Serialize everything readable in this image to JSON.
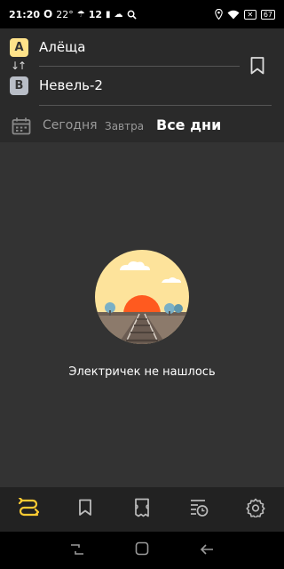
{
  "status_bar": {
    "time": "21:20",
    "temperature": "22°",
    "extra": "12",
    "battery": "67"
  },
  "route": {
    "from_badge": "A",
    "from": "Алёща",
    "to_badge": "B",
    "to": "Невель-2"
  },
  "dates": {
    "today": "Сегодня",
    "tomorrow": "Завтра",
    "all_days": "Все дни"
  },
  "empty_state": {
    "message": "Электричек не нашлось"
  },
  "tabs": [
    {
      "icon": "routes-icon",
      "active": true
    },
    {
      "icon": "bookmark-icon",
      "active": false
    },
    {
      "icon": "ticket-icon",
      "active": false
    },
    {
      "icon": "history-icon",
      "active": false
    },
    {
      "icon": "settings-icon",
      "active": false
    }
  ],
  "colors": {
    "accent": "#fecc33",
    "badge_a": "#fee28a",
    "badge_b": "#b9bec7",
    "sun": "#ff5a1f",
    "sky": "#fde39b"
  }
}
